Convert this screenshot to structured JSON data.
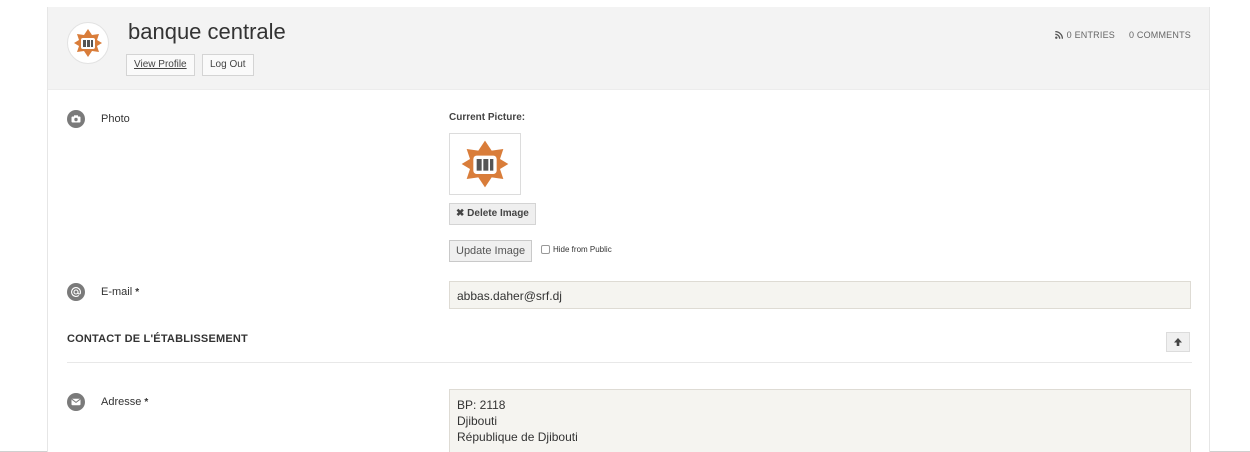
{
  "header": {
    "title": "banque centrale",
    "view_profile": "View Profile",
    "log_out": "Log Out",
    "entries": "0 ENTRIES",
    "comments": "0 COMMENTS"
  },
  "photo": {
    "label": "Photo",
    "current_picture_label": "Current Picture:",
    "delete_label": "Delete Image",
    "update_label": "Update Image",
    "hide_label": "Hide from Public"
  },
  "email": {
    "label": "E-mail",
    "required": "*",
    "value": "abbas.daher@srf.dj"
  },
  "section": {
    "title": "CONTACT DE L'ÉTABLISSEMENT"
  },
  "address": {
    "label": "Adresse",
    "required": "*",
    "lines": [
      "BP: 2118",
      "Djibouti",
      "République de Djibouti"
    ]
  },
  "colors": {
    "logo_orange": "#d97d3a",
    "icon_grey": "#7a7a7a",
    "field_bg": "#f5f4f0"
  }
}
